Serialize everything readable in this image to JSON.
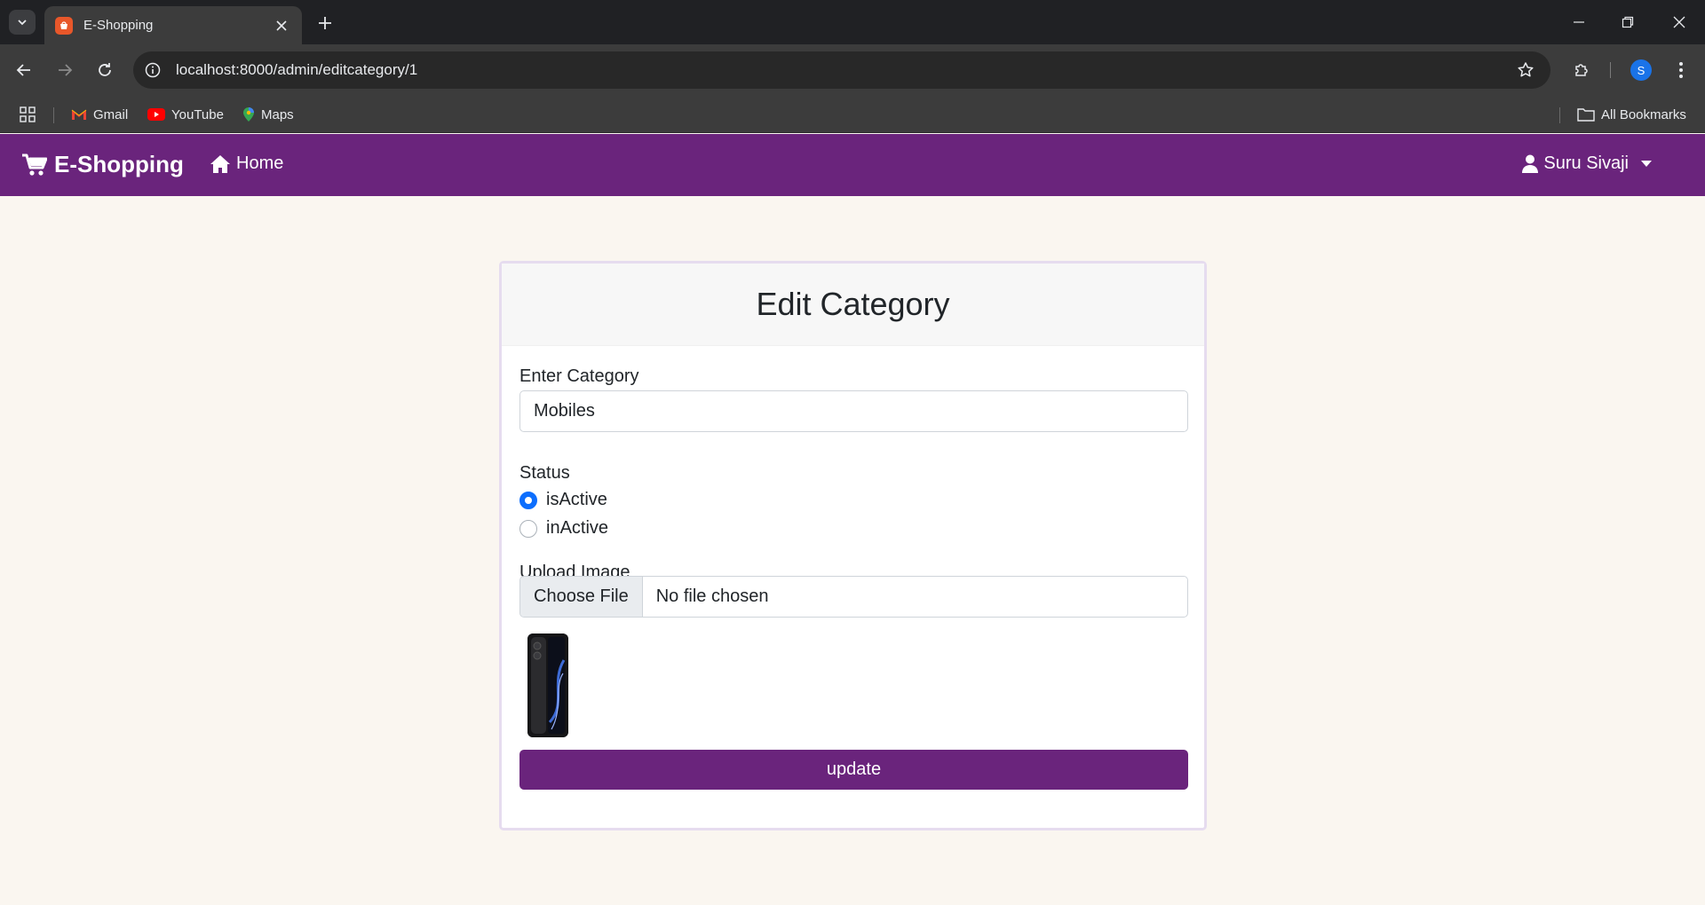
{
  "browser": {
    "tab_title": "E-Shopping",
    "url": "localhost:8000/admin/editcategory/1",
    "profile_initial": "S",
    "bookmarks": [
      {
        "label": "Gmail",
        "icon": "gmail-icon"
      },
      {
        "label": "YouTube",
        "icon": "youtube-icon"
      },
      {
        "label": "Maps",
        "icon": "maps-icon"
      }
    ],
    "all_bookmarks_label": "All Bookmarks"
  },
  "navbar": {
    "brand": "E-Shopping",
    "home_label": "Home",
    "user_name": "Suru Sivaji",
    "color": "#6a247c"
  },
  "form": {
    "title": "Edit Category",
    "category_label": "Enter Category",
    "category_value": "Mobiles",
    "status_label": "Status",
    "status_options": [
      {
        "label": "isActive",
        "checked": true
      },
      {
        "label": "inActive",
        "checked": false
      }
    ],
    "upload_label": "Upload Image",
    "choose_file_label": "Choose File",
    "file_status": "No file chosen",
    "update_label": "update"
  }
}
